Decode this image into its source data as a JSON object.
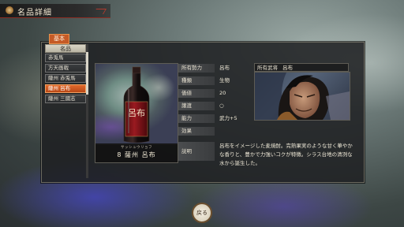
{
  "window": {
    "title": "名品詳細"
  },
  "tab": {
    "label": "基本"
  },
  "list": {
    "header": "名品",
    "items": [
      {
        "label": "赤兎馬",
        "selected": false
      },
      {
        "label": "方天画戟",
        "selected": false
      },
      {
        "label": "薩州 赤兎馬",
        "selected": false
      },
      {
        "label": "薩州 呂布",
        "selected": true
      },
      {
        "label": "薩州 三國志",
        "selected": false
      }
    ]
  },
  "item": {
    "furigana": "サッシュウリョフ",
    "name": "8 薩州 呂布",
    "bottle_label": "呂布"
  },
  "attributes": {
    "owner_force": {
      "label": "所有勢力",
      "value": "呂布"
    },
    "category": {
      "label": "種類",
      "value": "生物"
    },
    "price": {
      "label": "価値",
      "value": "20"
    },
    "transfer": {
      "label": "譲渡",
      "value": "○"
    },
    "ability": {
      "label": "能力",
      "value": "武力+5"
    },
    "effect": {
      "label": "効果",
      "value": ""
    },
    "description": {
      "label": "説明",
      "value": "呂布をイメージした麦焼酎。完熟果実のような甘く華やかな香りと、豊かで力強いコクが特徴。シラス台地の清冽な水から誕生した。"
    }
  },
  "officer": {
    "label": "所有武将",
    "name": "呂布"
  },
  "buttons": {
    "back": "戻る"
  },
  "colors": {
    "accent": "#c55a26",
    "panel": "#1e2022",
    "selected": "#e06a2c"
  }
}
